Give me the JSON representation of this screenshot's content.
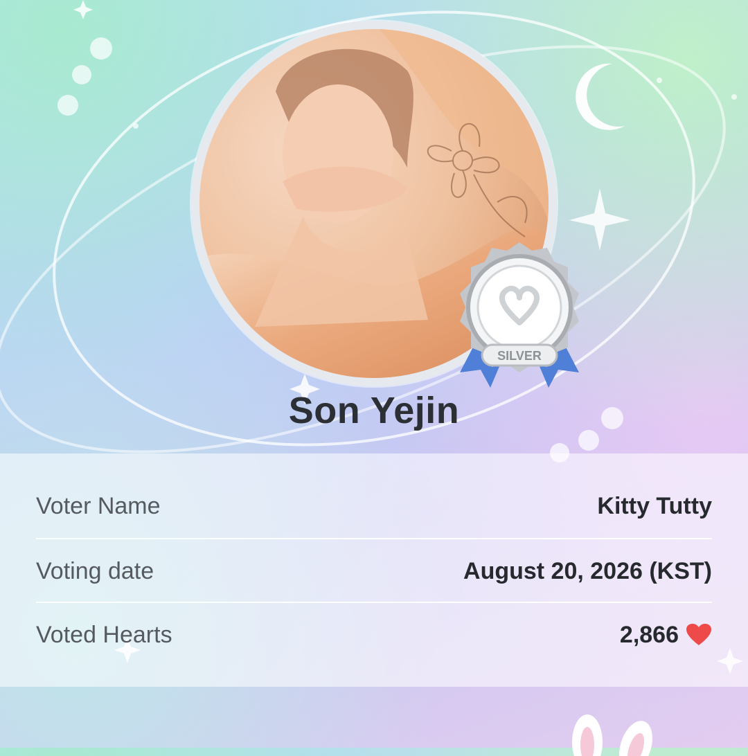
{
  "profile": {
    "name": "Son Yejin",
    "photo_icon": "celebrity-portrait-photo",
    "badge": {
      "label": "SILVER",
      "icon": "heart-logo-icon",
      "color": "#c0c4c8",
      "ribbon_color": "#4f7fd6"
    }
  },
  "vote_info": {
    "rows": [
      {
        "label": "Voter Name",
        "value": "Kitty Tutty"
      },
      {
        "label": "Voting date",
        "value": "August 20, 2026 (KST)"
      },
      {
        "label": "Voted Hearts",
        "value": "2,866",
        "icon": "heart-icon",
        "icon_color": "#ef4a4a"
      }
    ]
  }
}
